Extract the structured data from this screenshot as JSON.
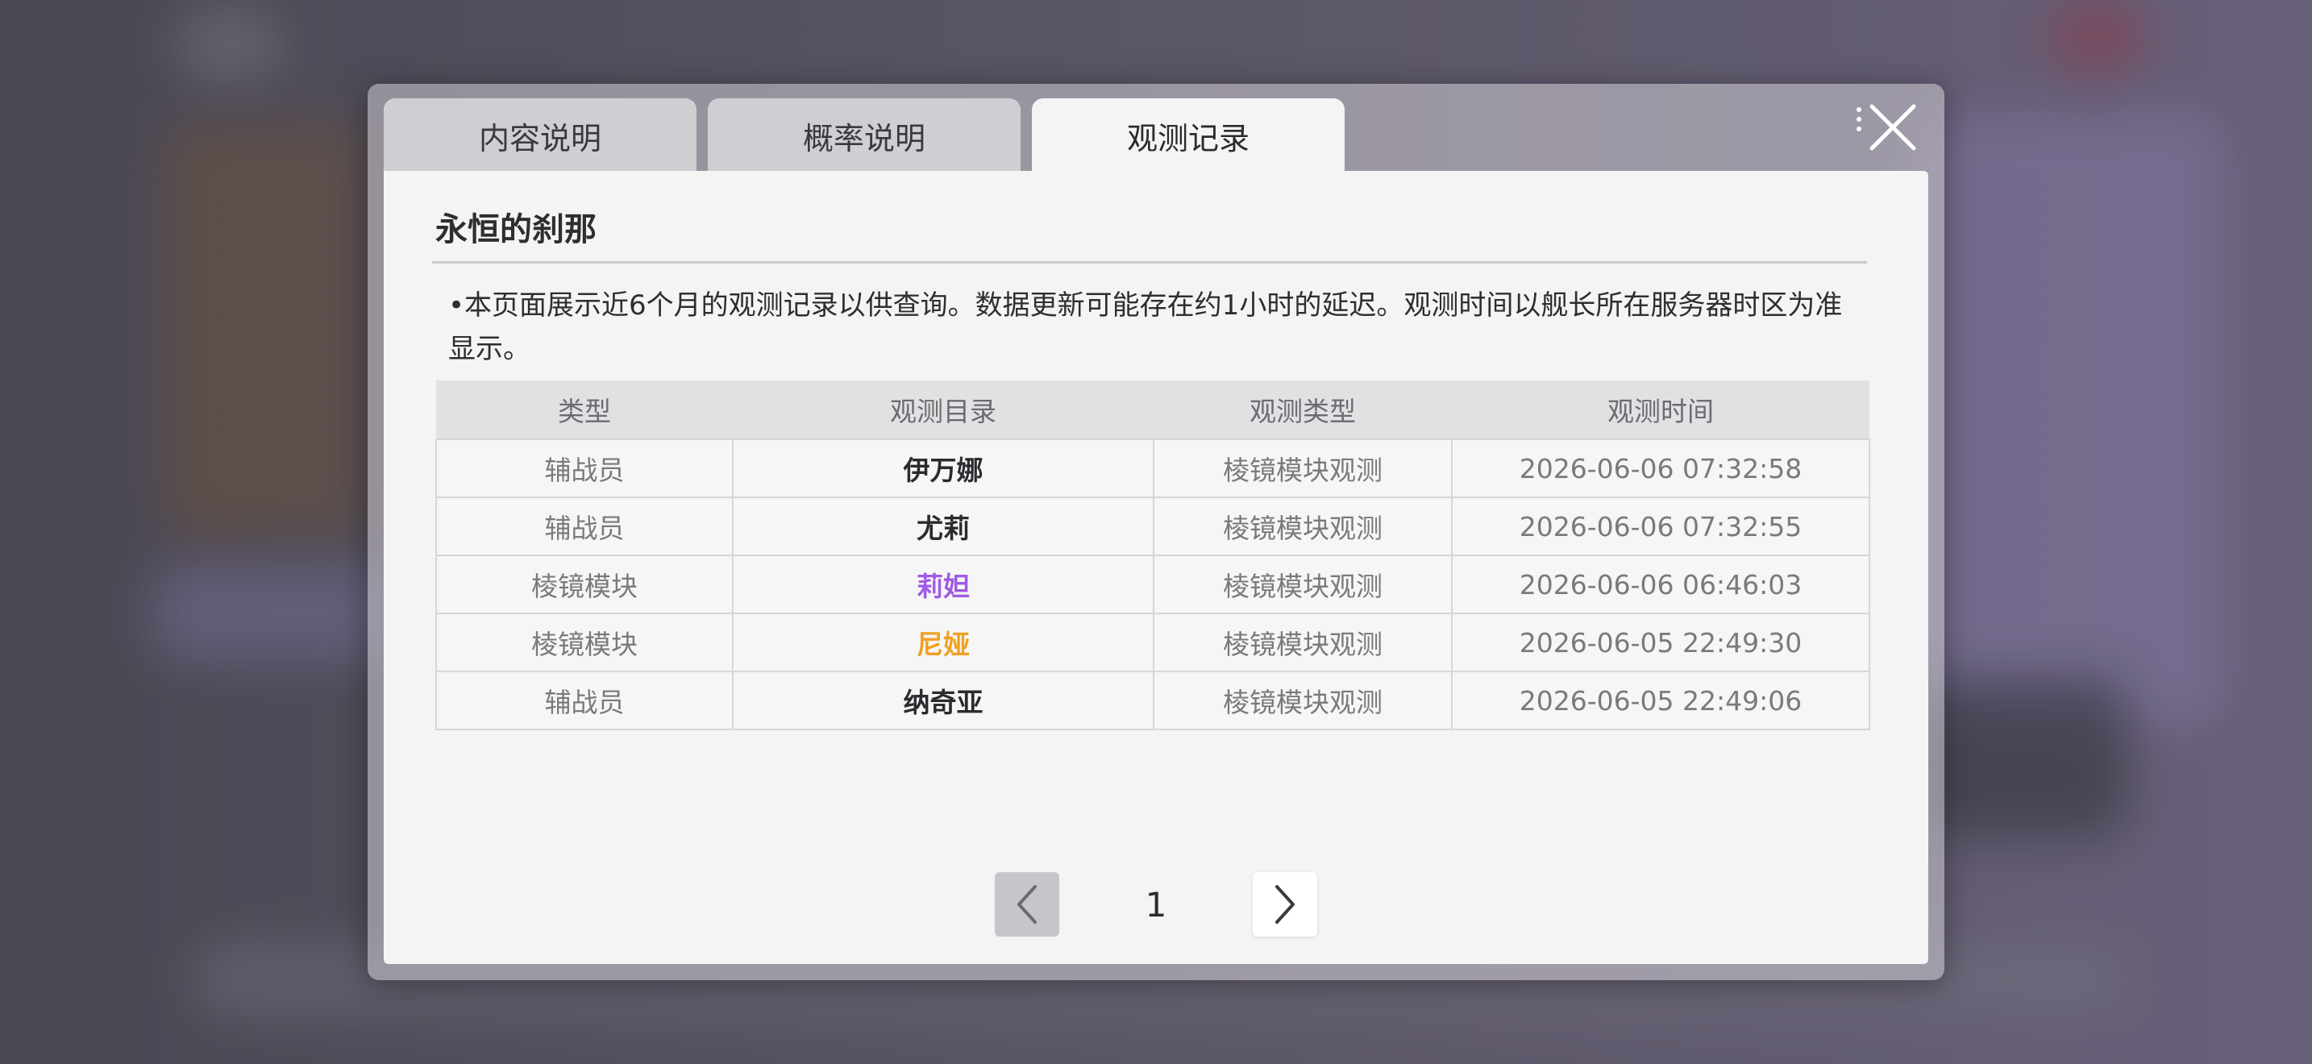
{
  "tabs": [
    {
      "label": "内容说明",
      "active": false
    },
    {
      "label": "概率说明",
      "active": false
    },
    {
      "label": "观测记录",
      "active": true
    }
  ],
  "panel": {
    "title": "永恒的刹那",
    "notice": "•本页面展示近6个月的观测记录以供查询。数据更新可能存在约1小时的延迟。观测时间以舰长所在服务器时区为准显示。"
  },
  "table": {
    "headers": [
      "类型",
      "观测目录",
      "观测类型",
      "观测时间"
    ],
    "rows": [
      {
        "type": "辅战员",
        "target": "伊万娜",
        "target_color": "#2b2b2f",
        "obs_type": "棱镜模块观测",
        "time": "2026-06-06 07:32:58"
      },
      {
        "type": "辅战员",
        "target": "尤莉",
        "target_color": "#2b2b2f",
        "obs_type": "棱镜模块观测",
        "time": "2026-06-06 07:32:55"
      },
      {
        "type": "棱镜模块",
        "target": "莉妲",
        "target_color": "#a05ae6",
        "obs_type": "棱镜模块观测",
        "time": "2026-06-06 06:46:03"
      },
      {
        "type": "棱镜模块",
        "target": "尼娅",
        "target_color": "#f0a020",
        "obs_type": "棱镜模块观测",
        "time": "2026-06-05 22:49:30"
      },
      {
        "type": "辅战员",
        "target": "纳奇亚",
        "target_color": "#2b2b2f",
        "obs_type": "棱镜模块观测",
        "time": "2026-06-05 22:49:06"
      }
    ]
  },
  "pager": {
    "current_page": "1"
  },
  "icons": {
    "close": "close-icon",
    "prev": "chevron-left-icon",
    "next": "chevron-right-icon"
  }
}
